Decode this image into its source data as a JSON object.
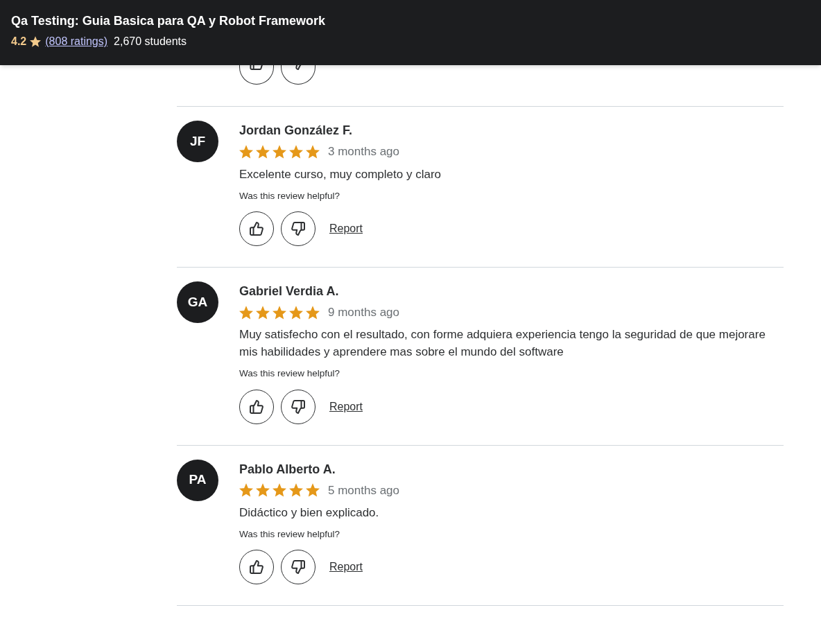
{
  "header": {
    "title": "Qa Testing: Guia Basica para QA y Robot Framework",
    "rating": "4.2",
    "ratings_link": "(808 ratings)",
    "students": "2,670 students"
  },
  "reviews": [
    {
      "initials": "JF",
      "name": "Jordan González F.",
      "stars": 5,
      "time": "3 months ago",
      "text": "Excelente curso, muy completo y claro",
      "helpful": "Was this review helpful?",
      "report": "Report"
    },
    {
      "initials": "GA",
      "name": "Gabriel Verdia A.",
      "stars": 5,
      "time": "9 months ago",
      "text": "Muy satisfecho con el resultado, con forme adquiera experiencia tengo la seguridad de que mejorare mis habilidades y aprendere mas sobre el mundo del software",
      "helpful": "Was this review helpful?",
      "report": "Report"
    },
    {
      "initials": "PA",
      "name": "Pablo Alberto A.",
      "stars": 5,
      "time": "5 months ago",
      "text": "Didáctico y bien explicado.",
      "helpful": "Was this review helpful?",
      "report": "Report"
    }
  ]
}
